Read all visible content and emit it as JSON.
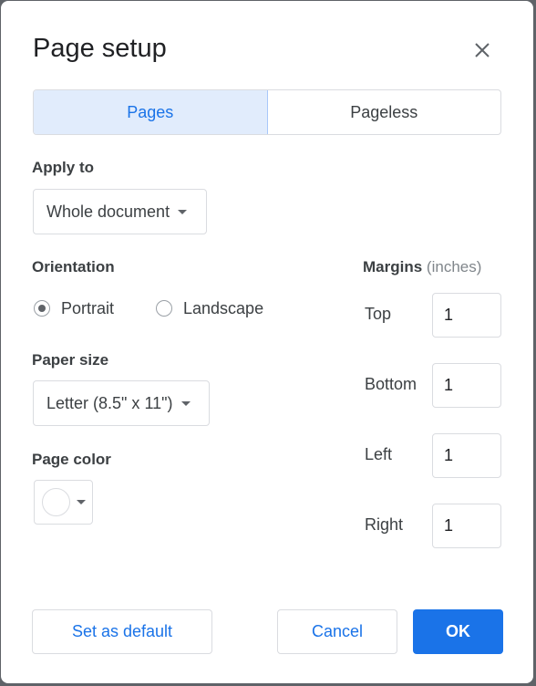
{
  "dialog": {
    "title": "Page setup",
    "close_icon": "close-icon"
  },
  "tabs": [
    {
      "label": "Pages",
      "active": true
    },
    {
      "label": "Pageless",
      "active": false
    }
  ],
  "apply_to": {
    "label": "Apply to",
    "value": "Whole document"
  },
  "orientation": {
    "label": "Orientation",
    "options": [
      {
        "label": "Portrait",
        "checked": true
      },
      {
        "label": "Landscape",
        "checked": false
      }
    ]
  },
  "paper_size": {
    "label": "Paper size",
    "value": "Letter (8.5\" x 11\")"
  },
  "page_color": {
    "label": "Page color",
    "value": "#ffffff"
  },
  "margins": {
    "label": "Margins",
    "unit": "(inches)",
    "fields": [
      {
        "label": "Top",
        "value": "1"
      },
      {
        "label": "Bottom",
        "value": "1"
      },
      {
        "label": "Left",
        "value": "1"
      },
      {
        "label": "Right",
        "value": "1"
      }
    ]
  },
  "buttons": {
    "set_default": "Set as default",
    "cancel": "Cancel",
    "ok": "OK"
  },
  "colors": {
    "accent": "#1a73e8",
    "active_tab_bg": "#e1ecfc"
  }
}
